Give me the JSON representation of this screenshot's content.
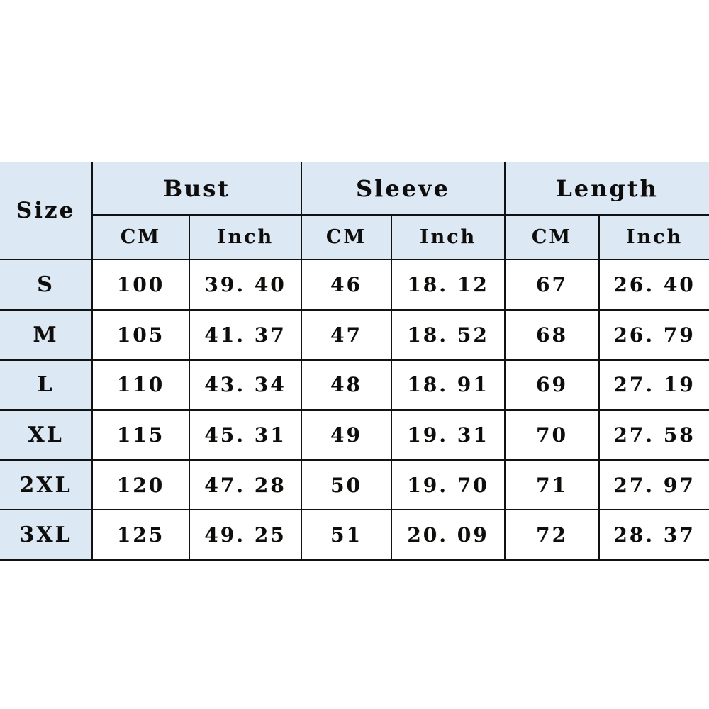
{
  "chart_data": {
    "type": "table",
    "title": "",
    "size_column_header": "Size",
    "group_headers": [
      "Bust",
      "Sleeve",
      "Length"
    ],
    "unit_headers": [
      "CM",
      "Inch",
      "CM",
      "Inch",
      "CM",
      "Inch"
    ],
    "columns": [
      "Size",
      "Bust CM",
      "Bust Inch",
      "Sleeve CM",
      "Sleeve Inch",
      "Length CM",
      "Length Inch"
    ],
    "sizes": [
      "S",
      "M",
      "L",
      "XL",
      "2XL",
      "3XL"
    ],
    "rows": [
      {
        "size": "S",
        "bust_cm": "100",
        "bust_inch": "39. 40",
        "sleeve_cm": "46",
        "sleeve_inch": "18. 12",
        "length_cm": "67",
        "length_inch": "26. 40"
      },
      {
        "size": "M",
        "bust_cm": "105",
        "bust_inch": "41. 37",
        "sleeve_cm": "47",
        "sleeve_inch": "18. 52",
        "length_cm": "68",
        "length_inch": "26. 79"
      },
      {
        "size": "L",
        "bust_cm": "110",
        "bust_inch": "43. 34",
        "sleeve_cm": "48",
        "sleeve_inch": "18. 91",
        "length_cm": "69",
        "length_inch": "27. 19"
      },
      {
        "size": "XL",
        "bust_cm": "115",
        "bust_inch": "45. 31",
        "sleeve_cm": "49",
        "sleeve_inch": "19. 31",
        "length_cm": "70",
        "length_inch": "27. 58"
      },
      {
        "size": "2XL",
        "bust_cm": "120",
        "bust_inch": "47. 28",
        "sleeve_cm": "50",
        "sleeve_inch": "19. 70",
        "length_cm": "71",
        "length_inch": "27. 97"
      },
      {
        "size": "3XL",
        "bust_cm": "125",
        "bust_inch": "49. 25",
        "sleeve_cm": "51",
        "sleeve_inch": "20. 09",
        "length_cm": "72",
        "length_inch": "28. 37"
      }
    ],
    "colors": {
      "header_background": "#dce8f4",
      "cell_background": "#ffffff",
      "border": "#121212",
      "text": "#0d0d0d",
      "page_background": "#ffffff"
    }
  }
}
